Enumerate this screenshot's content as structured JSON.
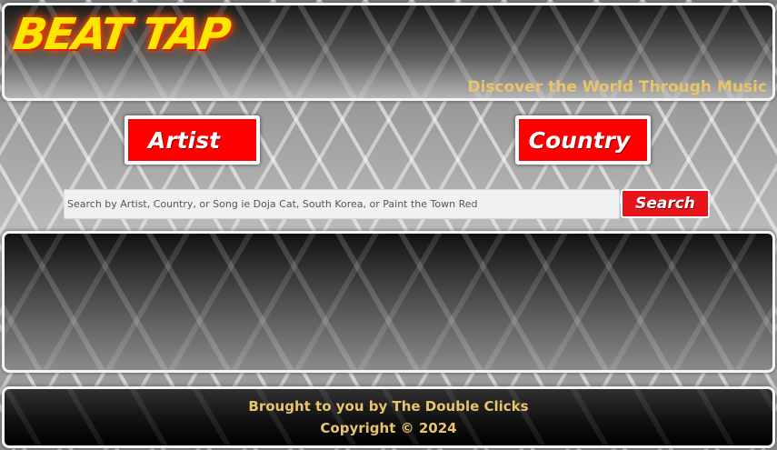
{
  "header": {
    "logo": "BEAT TAP",
    "tagline": "Discover the World Through Music"
  },
  "search": {
    "artist_label": "Artist",
    "country_label": "Country",
    "placeholder": "Search by Artist, Country, or Song ie Doja Cat, South Korea, or Paint the Town Red",
    "value": "",
    "button_label": "Search"
  },
  "footer": {
    "credit": "Brought to you by The Double Clicks",
    "copyright": "Copyright © 2024"
  },
  "colors": {
    "accent_red": "#ff0000",
    "logo_yellow": "#ffe600",
    "text_gold": "#e9c46a"
  }
}
